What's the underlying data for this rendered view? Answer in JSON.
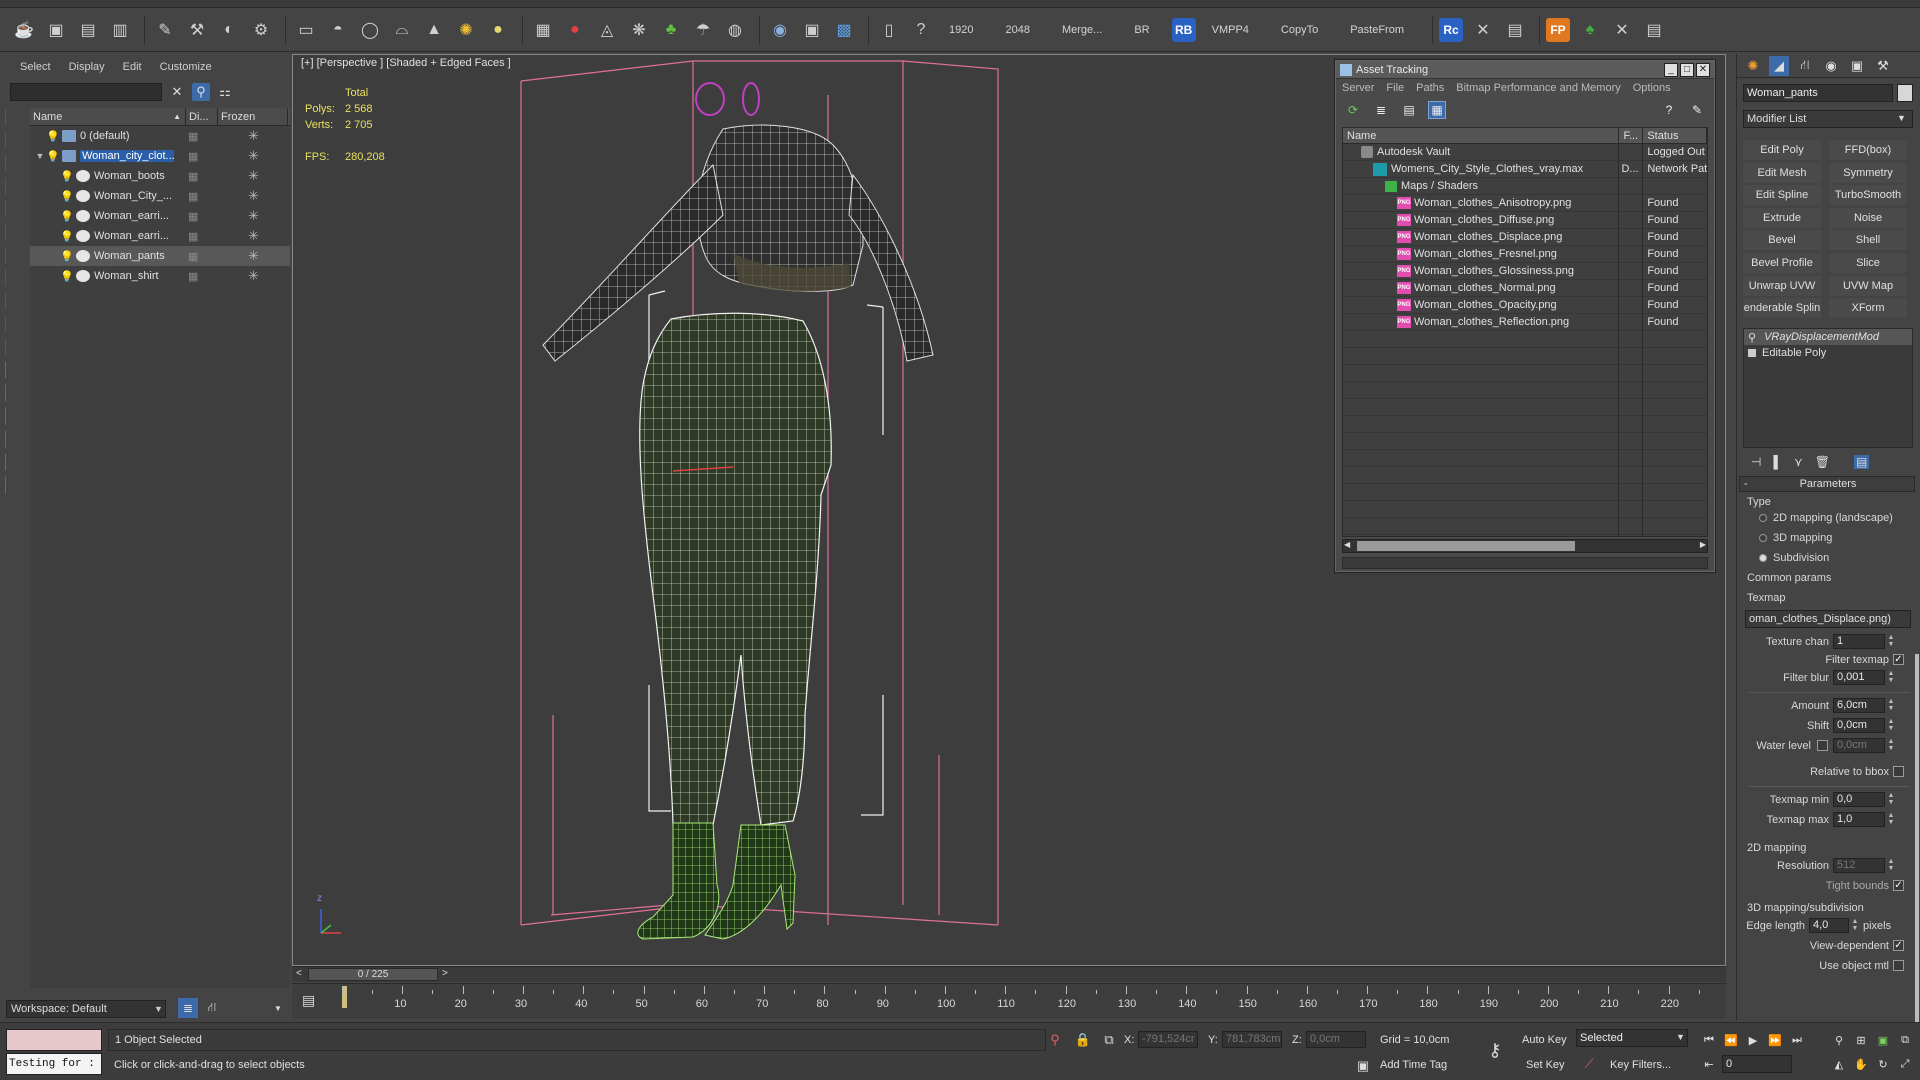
{
  "toolbar": {
    "text_items": [
      "1920",
      "2048",
      "Merge...",
      "BR",
      "VMPP4",
      "CopyTo",
      "PasteFrom"
    ],
    "badges": [
      {
        "label": "RB",
        "color": "#2a62c4"
      },
      {
        "label": "Rc",
        "color": "#2a62c4"
      },
      {
        "label": "FP",
        "color": "#e07820"
      }
    ]
  },
  "scene_explorer": {
    "menu": [
      "Select",
      "Display",
      "Edit",
      "Customize"
    ],
    "search_value": "",
    "columns": [
      "Name",
      "Di...",
      "Frozen"
    ],
    "rows": [
      {
        "name": "0 (default)",
        "level": 0,
        "type": "layer",
        "selected": false,
        "highlight": false
      },
      {
        "name": "Woman_city_clot...",
        "level": 0,
        "type": "layer",
        "selected": false,
        "highlight": true
      },
      {
        "name": "Woman_boots",
        "level": 1,
        "type": "object",
        "selected": false,
        "highlight": false
      },
      {
        "name": "Woman_City_...",
        "level": 1,
        "type": "group",
        "selected": false,
        "highlight": false
      },
      {
        "name": "Woman_earri...",
        "level": 1,
        "type": "object",
        "selected": false,
        "highlight": false
      },
      {
        "name": "Woman_earri...",
        "level": 1,
        "type": "object",
        "selected": false,
        "highlight": false
      },
      {
        "name": "Woman_pants",
        "level": 1,
        "type": "object",
        "selected": true,
        "highlight": false
      },
      {
        "name": "Woman_shirt",
        "level": 1,
        "type": "object",
        "selected": false,
        "highlight": false
      }
    ],
    "workspace": "Workspace: Default"
  },
  "viewport": {
    "label": "[+] [Perspective ] [Shaded + Edged Faces ]",
    "stats": {
      "header": "Total",
      "polys_label": "Polys:",
      "polys": "2 568",
      "verts_label": "Verts:",
      "verts": "2 705",
      "fps_label": "FPS:",
      "fps": "280,208"
    },
    "axis_label": "z"
  },
  "asset_tracking": {
    "title": "Asset Tracking",
    "menu": [
      "Server",
      "File",
      "Paths",
      "Bitmap Performance and Memory",
      "Options"
    ],
    "columns": [
      "Name",
      "F...",
      "Status"
    ],
    "rows": [
      {
        "name": "Autodesk Vault",
        "icon": "vault",
        "indent": 1,
        "f": "",
        "status": "Logged Out"
      },
      {
        "name": "Womens_City_Style_Clothes_vray.max",
        "icon": "max",
        "indent": 2,
        "f": "D...",
        "status": "Network Path"
      },
      {
        "name": "Maps / Shaders",
        "icon": "folder",
        "indent": 3,
        "f": "",
        "status": ""
      },
      {
        "name": "Woman_clothes_Anisotropy.png",
        "icon": "png",
        "indent": 4,
        "f": "",
        "status": "Found"
      },
      {
        "name": "Woman_clothes_Diffuse.png",
        "icon": "png",
        "indent": 4,
        "f": "",
        "status": "Found"
      },
      {
        "name": "Woman_clothes_Displace.png",
        "icon": "png",
        "indent": 4,
        "f": "",
        "status": "Found"
      },
      {
        "name": "Woman_clothes_Fresnel.png",
        "icon": "png",
        "indent": 4,
        "f": "",
        "status": "Found"
      },
      {
        "name": "Woman_clothes_Glossiness.png",
        "icon": "png",
        "indent": 4,
        "f": "",
        "status": "Found"
      },
      {
        "name": "Woman_clothes_Normal.png",
        "icon": "png",
        "indent": 4,
        "f": "",
        "status": "Found"
      },
      {
        "name": "Woman_clothes_Opacity.png",
        "icon": "png",
        "indent": 4,
        "f": "",
        "status": "Found"
      },
      {
        "name": "Woman_clothes_Reflection.png",
        "icon": "png",
        "indent": 4,
        "f": "",
        "status": "Found"
      }
    ]
  },
  "command_panel": {
    "object_name": "Woman_pants",
    "modifier_list": "Modifier List",
    "modifier_buttons": [
      [
        "Edit Poly",
        "FFD(box)"
      ],
      [
        "Edit Mesh",
        "Symmetry"
      ],
      [
        "Edit Spline",
        "TurboSmooth"
      ],
      [
        "Extrude",
        "Noise"
      ],
      [
        "Bevel",
        "Shell"
      ],
      [
        "Bevel Profile",
        "Slice"
      ],
      [
        "Unwrap UVW",
        "UVW Map"
      ],
      [
        "enderable Splin",
        "XForm"
      ]
    ],
    "modifier_stack": [
      {
        "name": "VRayDisplacementMod",
        "selected": true
      },
      {
        "name": "Editable Poly",
        "selected": false
      }
    ],
    "parameters": {
      "title": "Parameters",
      "type_label": "Type",
      "type_options": [
        {
          "label": "2D mapping (landscape)",
          "on": false
        },
        {
          "label": "3D mapping",
          "on": false
        },
        {
          "label": "Subdivision",
          "on": true
        }
      ],
      "common_params": "Common params",
      "texmap_label": "Texmap",
      "texmap_value": "oman_clothes_Displace.png)",
      "texture_chan_label": "Texture chan",
      "texture_chan": "1",
      "filter_texmap_label": "Filter texmap",
      "filter_blur_label": "Filter blur",
      "filter_blur": "0,001",
      "amount_label": "Amount",
      "amount": "6,0cm",
      "shift_label": "Shift",
      "shift": "0,0cm",
      "water_level_label": "Water level",
      "water_level": "0,0cm",
      "relative_label": "Relative to bbox",
      "texmap_min_label": "Texmap min",
      "texmap_min": "0,0",
      "texmap_max_label": "Texmap max",
      "texmap_max": "1,0",
      "mapping2d_title": "2D mapping",
      "resolution_label": "Resolution",
      "resolution": "512",
      "tight_bounds_label": "Tight bounds",
      "mapping3d_title": "3D mapping/subdivision",
      "edge_length_label": "Edge length",
      "edge_length": "4,0",
      "pixels_label": "pixels",
      "view_dependent_label": "View-dependent",
      "use_object_mtl_label": "Use object mtl"
    }
  },
  "timeline": {
    "frame_display": "0 / 225",
    "tick_labels": [
      "10",
      "20",
      "30",
      "40",
      "50",
      "60",
      "70",
      "80",
      "90",
      "100",
      "110",
      "120",
      "130",
      "140",
      "150",
      "160",
      "170",
      "180",
      "190",
      "200",
      "210",
      "220"
    ]
  },
  "statusbar": {
    "maxscript_text": "Testing for :",
    "selection_info": "1 Object Selected",
    "prompt": "Click or click-and-drag to select objects",
    "x_label": "X:",
    "x_value": "-791,524cr",
    "y_label": "Y:",
    "y_value": "781,783cm",
    "z_label": "Z:",
    "z_value": "0,0cm",
    "grid": "Grid = 10,0cm",
    "add_time_tag": "Add Time Tag",
    "auto_key": "Auto Key",
    "set_key": "Set Key",
    "selected_dropdown": "Selected",
    "key_filters": "Key Filters...",
    "frame": "0"
  },
  "colors": {
    "selection_blue": "#2a5ea8",
    "wire_green": "#a8e878",
    "bbox_pink": "#e0709a",
    "stats_yellow": "#e8e060"
  }
}
